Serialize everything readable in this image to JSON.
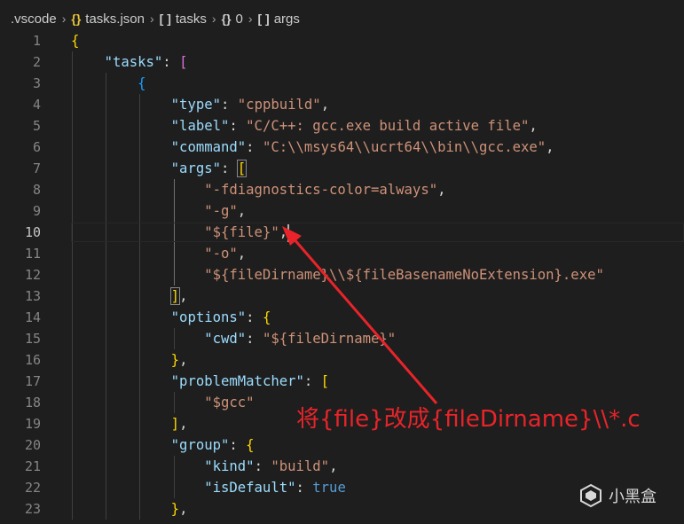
{
  "breadcrumb": {
    "items": [
      {
        "label": ".vscode",
        "icon": ""
      },
      {
        "label": "tasks.json",
        "icon": "{}"
      },
      {
        "label": "tasks",
        "icon": "[ ]"
      },
      {
        "label": "0",
        "icon": "{}"
      },
      {
        "label": "args",
        "icon": "[ ]"
      }
    ]
  },
  "editor": {
    "active_line": 10,
    "line_numbers": [
      "1",
      "2",
      "3",
      "4",
      "5",
      "6",
      "7",
      "8",
      "9",
      "10",
      "11",
      "12",
      "13",
      "14",
      "15",
      "16",
      "17",
      "18",
      "19",
      "20",
      "21",
      "22",
      "23"
    ],
    "code": {
      "l1": "{",
      "l2_key": "\"tasks\"",
      "l2_rest": ": ",
      "l2_br": "[",
      "l3": "{",
      "l4_key": "\"type\"",
      "l4_val": "\"cppbuild\"",
      "l5_key": "\"label\"",
      "l5_val": "\"C/C++: gcc.exe build active file\"",
      "l6_key": "\"command\"",
      "l6_val": "\"C:\\\\msys64\\\\ucrt64\\\\bin\\\\gcc.exe\"",
      "l7_key": "\"args\"",
      "l7_br": "[",
      "l8_val": "\"-fdiagnostics-color=always\"",
      "l9_val": "\"-g\"",
      "l10_val": "\"${file}\"",
      "l11_val": "\"-o\"",
      "l12_val": "\"${fileDirname}\\\\${fileBasenameNoExtension}.exe\"",
      "l13_br": "]",
      "l14_key": "\"options\"",
      "l14_br": "{",
      "l15_key": "\"cwd\"",
      "l15_val": "\"${fileDirname}\"",
      "l16_br": "}",
      "l17_key": "\"problemMatcher\"",
      "l17_br": "[",
      "l18_val": "\"$gcc\"",
      "l19_br": "]",
      "l20_key": "\"group\"",
      "l20_br": "{",
      "l21_key": "\"kind\"",
      "l21_val": "\"build\"",
      "l22_key": "\"isDefault\"",
      "l22_val": "true",
      "l23_br": "}"
    }
  },
  "annotation": {
    "text": "将{file}改成{fileDirname}\\\\*.c",
    "color": "#e8242a"
  },
  "watermark": {
    "text": "小黑盒"
  },
  "colors": {
    "key": "#9cdcfe",
    "string": "#ce9178",
    "bracket1": "#ffd700",
    "bracket2": "#da70d6",
    "bracket3": "#179fff",
    "keyword": "#569cd6"
  }
}
